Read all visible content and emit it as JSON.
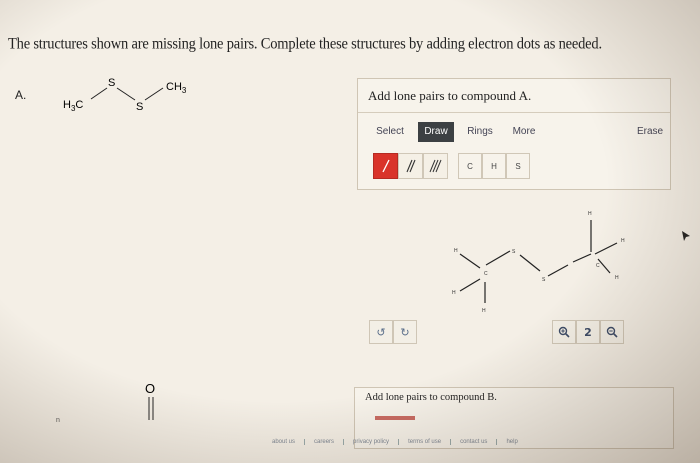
{
  "question": "The structures shown are missing lone pairs. Complete these structures by adding electron dots as needed.",
  "part_a": {
    "label": "A.",
    "atoms": {
      "left_methyl": "H",
      "left_methyl_sub": "3",
      "left_methyl_c": "C",
      "s1": "S",
      "s2": "S",
      "right_methyl": "CH",
      "right_methyl_sub": "3"
    }
  },
  "panel_a": {
    "title": "Add lone pairs to compound A.",
    "tabs": {
      "select": "Select",
      "draw": "Draw",
      "rings": "Rings",
      "more": "More",
      "erase": "Erase"
    },
    "elements": {
      "c": "C",
      "h": "H",
      "s": "S"
    },
    "canvas_atoms": {
      "h_top": "H",
      "h_right": "H",
      "h_left_top": "H",
      "s_left": "S",
      "c_left": "C",
      "s_right": "S",
      "c_right": "C",
      "h_right_lower": "H",
      "h_left_bottom": "H",
      "h_bottom": "H"
    }
  },
  "part_b": {
    "atom_o": "O"
  },
  "panel_b": {
    "title": "Add lone pairs to compound B."
  },
  "footer": {
    "links": [
      "about us",
      "careers",
      "privacy policy",
      "terms of use",
      "contact us",
      "help"
    ]
  },
  "edge_mark": "n",
  "colors": {
    "accent_red": "#d9332a",
    "active_tab": "#3c4043"
  }
}
